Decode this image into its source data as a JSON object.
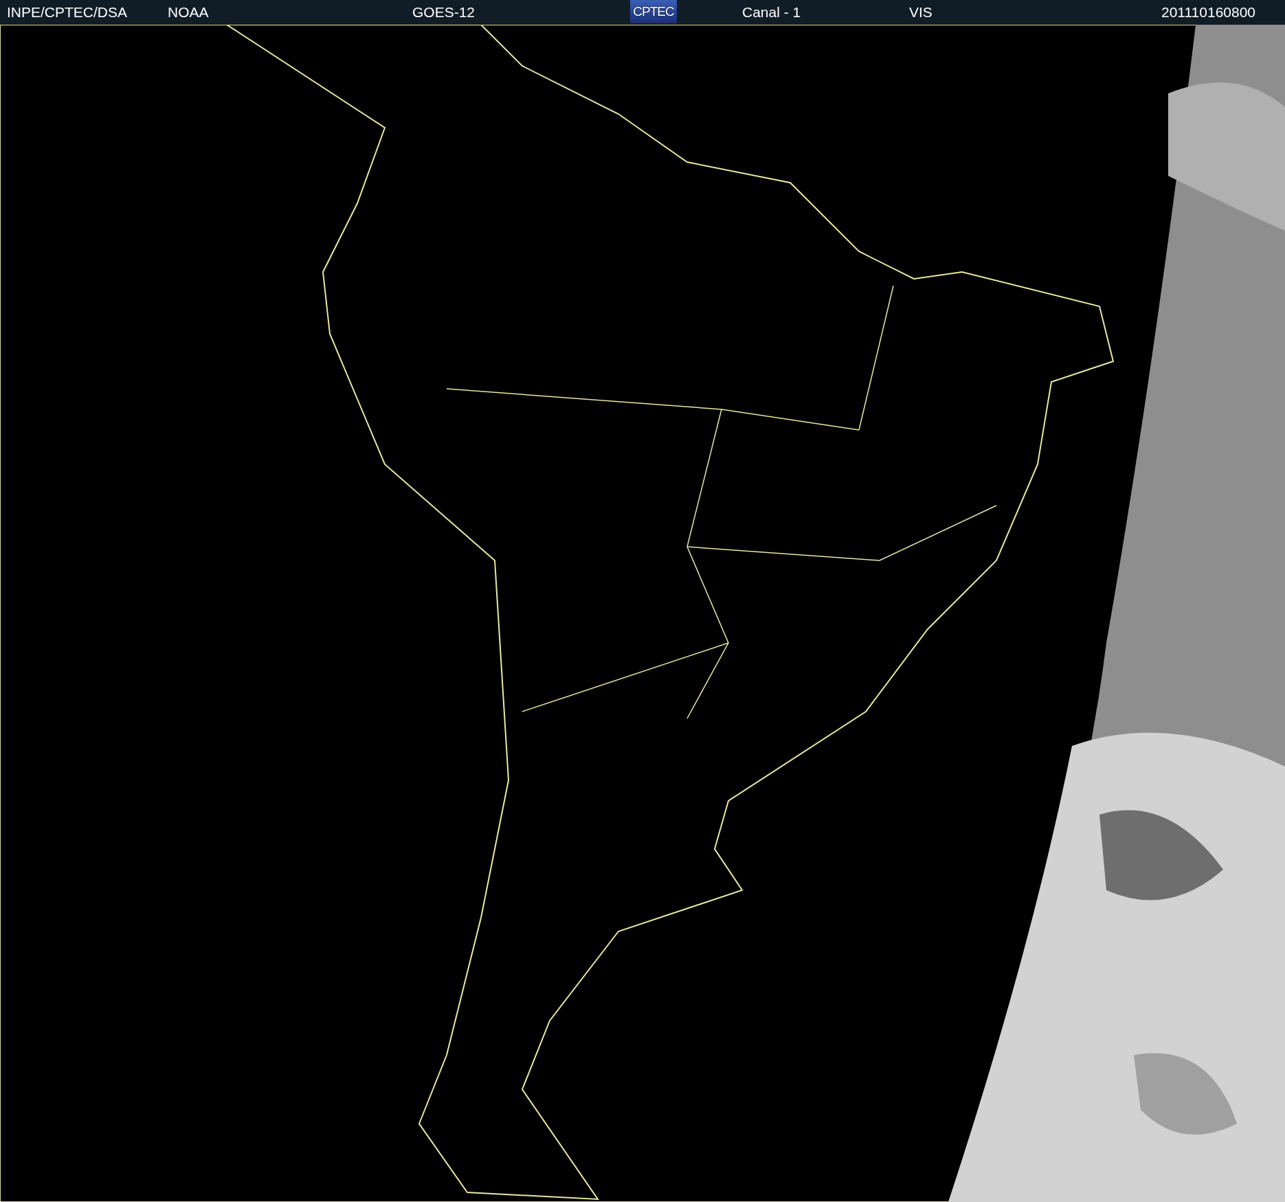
{
  "header": {
    "items": [
      {
        "kind": "text",
        "text": "INPE/CPTEC/DSA"
      },
      {
        "kind": "text",
        "text": "NOAA"
      },
      {
        "kind": "text",
        "text": "GOES-12"
      },
      {
        "kind": "logo",
        "text": "CPTEC"
      },
      {
        "kind": "text",
        "text": "Canal - 1"
      },
      {
        "kind": "text",
        "text": "VIS"
      },
      {
        "kind": "text",
        "text": "201110160800"
      }
    ]
  }
}
